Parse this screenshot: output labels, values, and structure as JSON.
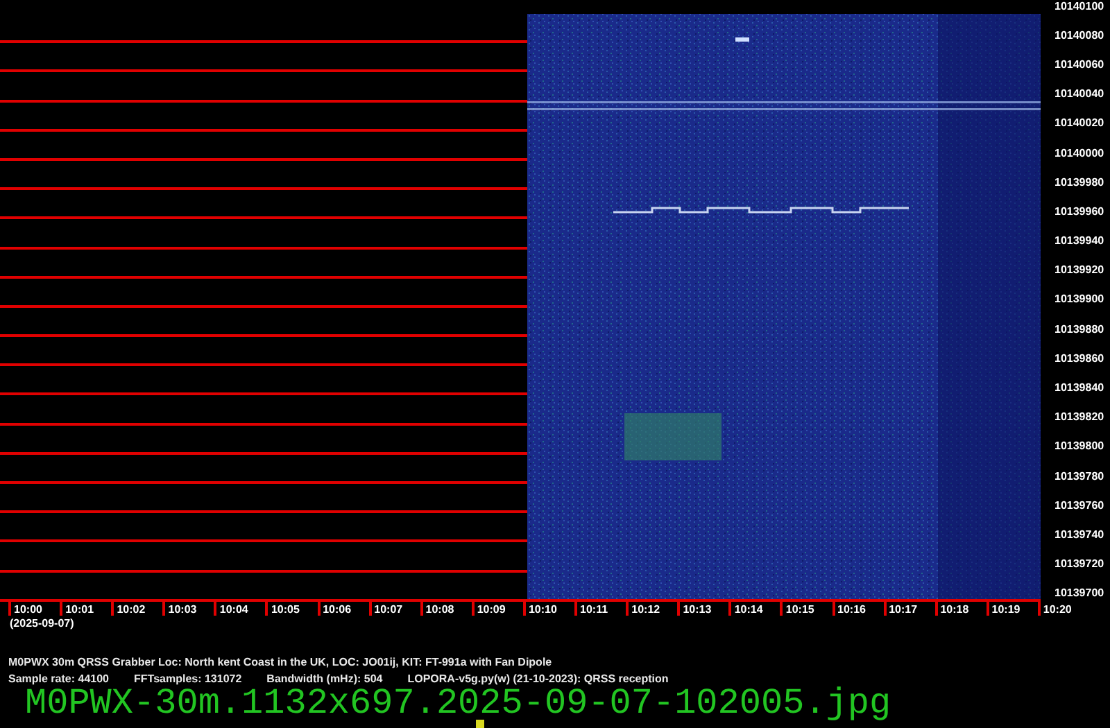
{
  "frequency_axis": {
    "labels": [
      "10140100",
      "10140080",
      "10140060",
      "10140040",
      "10140020",
      "10140000",
      "10139980",
      "10139960",
      "10139940",
      "10139920",
      "10139900",
      "10139880",
      "10139860",
      "10139840",
      "10139820",
      "10139800",
      "10139780",
      "10139760",
      "10139740",
      "10139720",
      "10139700"
    ]
  },
  "time_axis": {
    "labels": [
      "10:00",
      "10:01",
      "10:02",
      "10:03",
      "10:04",
      "10:05",
      "10:06",
      "10:07",
      "10:08",
      "10:09",
      "10:10",
      "10:11",
      "10:12",
      "10:13",
      "10:14",
      "10:15",
      "10:16",
      "10:17",
      "10:18",
      "10:19",
      "10:20"
    ],
    "date": "(2025-09-07)"
  },
  "info": {
    "station_line": "M0PWX 30m QRSS Grabber Loc: North kent Coast in the UK, LOC: JO01ij, KIT: FT-991a with Fan Dipole",
    "parameters": [
      "Sample rate: 44100",
      "FFTsamples: 131072",
      "Bandwidth (mHz): 504",
      "LOPORA-v5g.py(w) (21-10-2023): QRSS reception"
    ]
  },
  "filename": "M0PWX-30m.1132x697.2025-09-07-102005.jpg"
}
